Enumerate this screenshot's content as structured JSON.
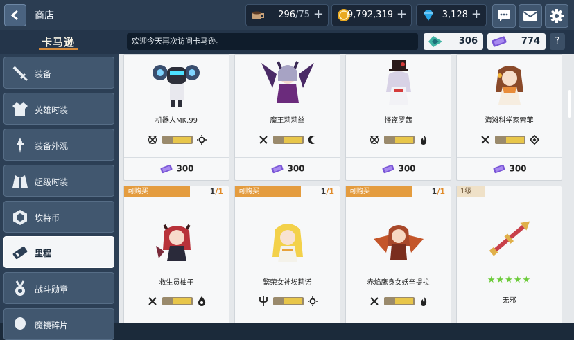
{
  "header": {
    "back_icon": "chevron-left-icon",
    "title": "商店",
    "currencies": [
      {
        "name": "stamina",
        "icon": "coffee-cup-icon",
        "value": "296",
        "max": "/75"
      },
      {
        "name": "gold",
        "icon": "gold-coin-icon",
        "value": "9,792,319"
      },
      {
        "name": "gems",
        "icon": "diamond-icon",
        "value": "3,128"
      }
    ],
    "buttons": [
      "chat-icon",
      "mail-icon",
      "gear-icon"
    ]
  },
  "subbar": {
    "brand": "卡马逊",
    "notice": "欢迎今天再次访问卡马逊。",
    "tickets": [
      {
        "icon": "green-ticket-icon",
        "value": "306"
      },
      {
        "icon": "purple-ticket-icon",
        "value": "774"
      }
    ],
    "help": "?"
  },
  "sidebar": {
    "items": [
      {
        "label": "装备",
        "icon": "sword-icon",
        "active": false
      },
      {
        "label": "英雄时装",
        "icon": "costume-icon",
        "active": false
      },
      {
        "label": "装备外观",
        "icon": "weapon-skin-icon",
        "active": false
      },
      {
        "label": "超级时装",
        "icon": "super-costume-icon",
        "active": false
      },
      {
        "label": "坎特币",
        "icon": "hex-coin-icon",
        "active": false
      },
      {
        "label": "里程",
        "icon": "ticket-icon",
        "active": true
      },
      {
        "label": "战斗勋章",
        "icon": "medal-icon",
        "active": false
      },
      {
        "label": "魔镜碎片",
        "icon": "mirror-icon",
        "active": false
      }
    ]
  },
  "cards": [
    {
      "name": "机器人MK.99",
      "price": "300",
      "attr_left": "crossed-swords-off-icon",
      "attr_right": "sun-icon"
    },
    {
      "name": "魔王莉莉丝",
      "price": "300",
      "attr_left": "crossed-swords-icon",
      "attr_right": "moon-icon"
    },
    {
      "name": "怪盗罗茜",
      "price": "300",
      "attr_left": "crossed-swords-off-icon",
      "attr_right": "fire-icon"
    },
    {
      "name": "海滩科学家索菲",
      "price": "300",
      "attr_left": "crossed-swords-icon",
      "attr_right": "diamond-outline-icon"
    },
    {
      "name": "救生员柚子",
      "tag": "可购买",
      "limit_a": "1",
      "limit_b": "/1",
      "attr_left": "crossed-swords-icon",
      "attr_right": "water-drop-icon"
    },
    {
      "name": "繁荣女神埃莉诺",
      "tag": "可购买",
      "limit_a": "1",
      "limit_b": "/1",
      "attr_left": "trident-icon",
      "attr_right": "sun-icon"
    },
    {
      "name": "赤焰鹰身女妖辛提拉",
      "tag": "可购买",
      "limit_a": "1",
      "limit_b": "/1",
      "attr_left": "crossed-swords-icon",
      "attr_right": "fire-icon"
    },
    {
      "name": "无邪",
      "tag": "1级",
      "stars": "★★★★★",
      "attr_left": "",
      "attr_right": ""
    }
  ],
  "colors": {
    "accent_orange": "#e49c3f",
    "ticket_purple": "#7a56d6",
    "star_green": "#6ccb3a"
  }
}
